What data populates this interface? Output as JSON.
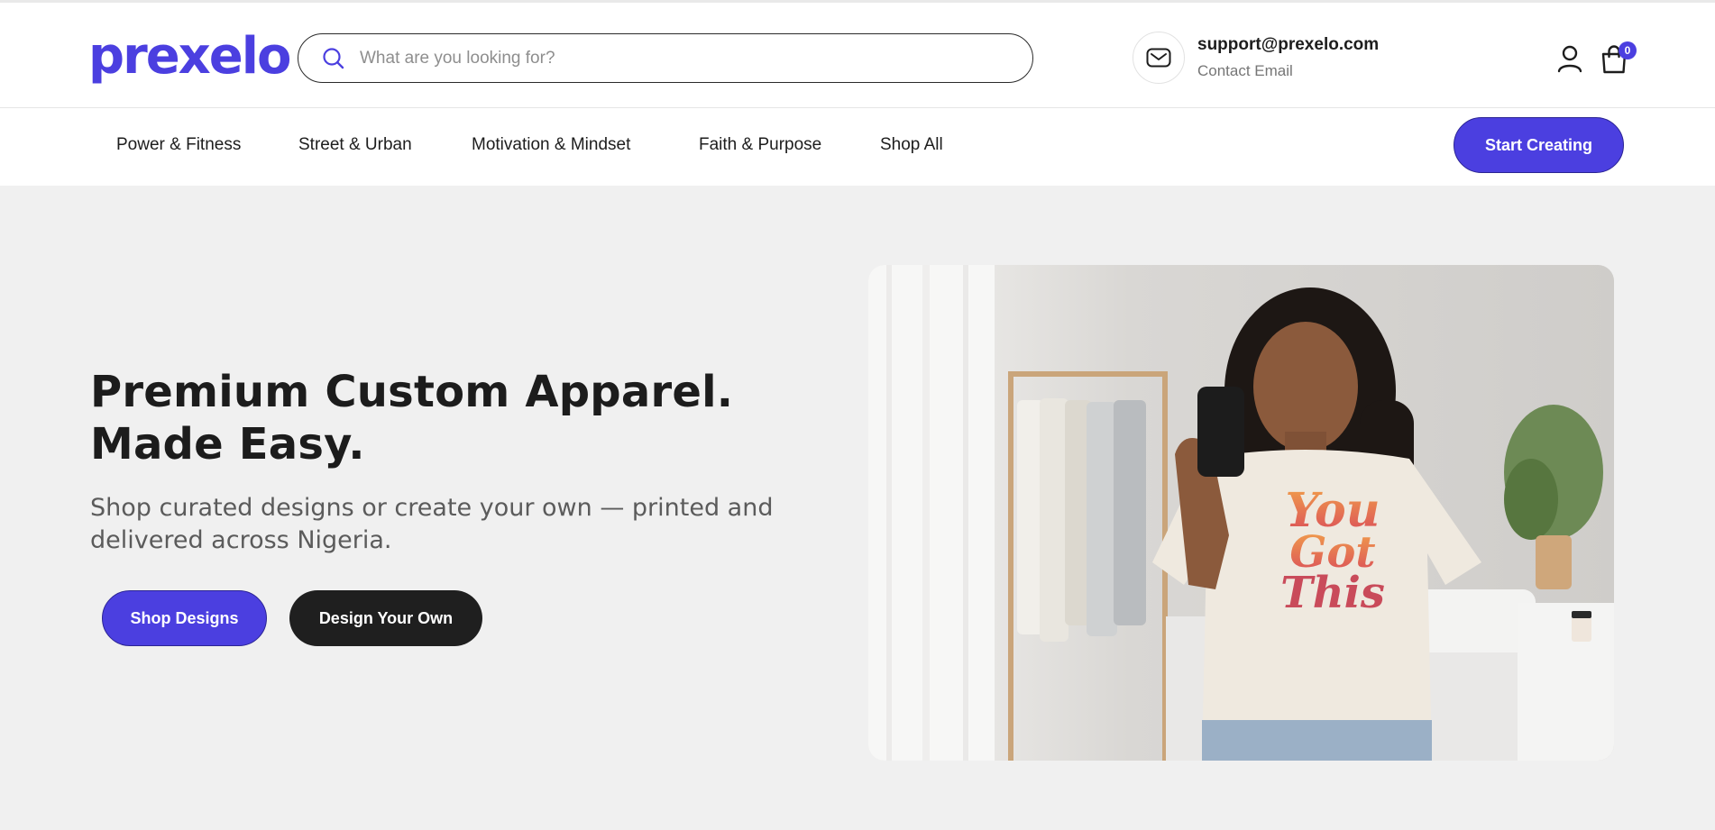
{
  "brand": {
    "logo_text": "prexelo",
    "accent_color": "#4b3fe0",
    "dark_button_color": "#1f1f1f",
    "hero_background": "#f0f0f0"
  },
  "header": {
    "search": {
      "placeholder": "What are you looking for?",
      "icon": "search-icon"
    },
    "contact": {
      "icon": "mail-icon",
      "email": "support@prexelo.com",
      "label": "Contact Email"
    },
    "account_icon": "user-icon",
    "cart": {
      "icon": "shopping-bag-icon",
      "count": "0"
    }
  },
  "nav": {
    "items": [
      {
        "label": "Power & Fitness"
      },
      {
        "label": "Street & Urban"
      },
      {
        "label": "Motivation & Mindset"
      },
      {
        "label": "Faith & Purpose"
      },
      {
        "label": "Shop All"
      }
    ],
    "cta_label": "Start Creating"
  },
  "hero": {
    "title_line1": "Premium Custom Apparel.",
    "title_line2": "Made Easy.",
    "subtitle": "Shop curated designs or create your own — printed and delivered across Nigeria.",
    "primary_button": "Shop Designs",
    "secondary_button": "Design Your Own",
    "image": {
      "subject": "woman-selfie-tshirt-photo",
      "shirt_print": "You Got This"
    }
  }
}
